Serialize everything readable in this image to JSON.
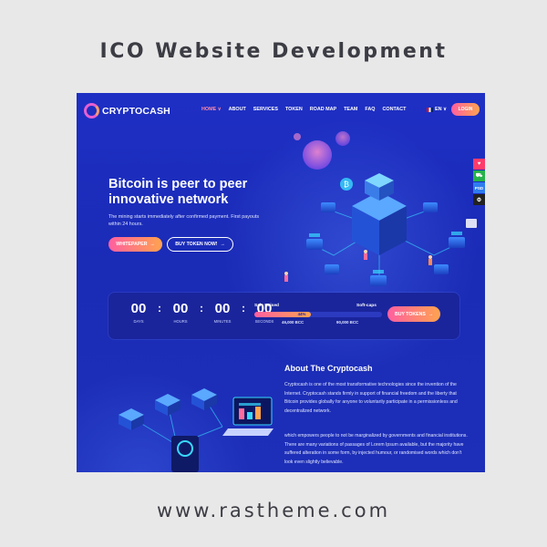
{
  "banner": {
    "heading": "ICO Website Development",
    "footer_url": "www.rastheme.com"
  },
  "nav": {
    "logo_text": "CRYPTOCASH",
    "menu": [
      "HOME ∨",
      "ABOUT",
      "SERVICES",
      "TOKEN",
      "ROAD MAP",
      "TEAM",
      "FAQ",
      "CONTACT"
    ],
    "active_index": 0,
    "language": "EN ∨",
    "login_label": "LOGIN"
  },
  "side_icons": [
    "heart-icon",
    "cart-icon",
    "PSD",
    "gear-icon"
  ],
  "hero": {
    "title": "Bitcoin is peer to peer innovative network",
    "subtitle": "The mining starts immediately after confirmed payment. First payouts within 24 hours.",
    "whitepaper_label": "WHITEPAPER",
    "buy_label": "BUY TOKEN NOW!"
  },
  "countdown": {
    "units": [
      {
        "value": "00",
        "label": "DAYS"
      },
      {
        "value": "00",
        "label": "HOURS"
      },
      {
        "value": "00",
        "label": "MINUTES"
      },
      {
        "value": "00",
        "label": "SECONDS"
      }
    ],
    "sale_raised_label": "Sale Raised",
    "soft_caps_label": "Soft-caps",
    "progress_percent": 44,
    "progress_label": "44%",
    "raised_value": "46,000 BCC",
    "softcap_value": "90,000 BCC",
    "buy_tokens_label": "BUY TOKENS"
  },
  "about": {
    "title": "About The Cryptocash",
    "paragraph1": "Cryptocash is one of the most transformative technologies since the invention of the Internet. Cryptocash stands firmly in support of financial freedom and the liberty that Bitcoin provides globally for anyone to voluntarily participate in a permissionless and decentralized network.",
    "paragraph2": "which empowers people to not be marginalized by governments and financial institutions. There are many variations of passages of Lorem Ipsum available, but the majority have suffered alteration in some form, by injected humour, or randomised words which don't look even slightly believable."
  },
  "colors": {
    "background": "#1d2fbd",
    "accent_start": "#ff5fa0",
    "accent_end": "#ffa34f",
    "panel": "#1a259c"
  }
}
